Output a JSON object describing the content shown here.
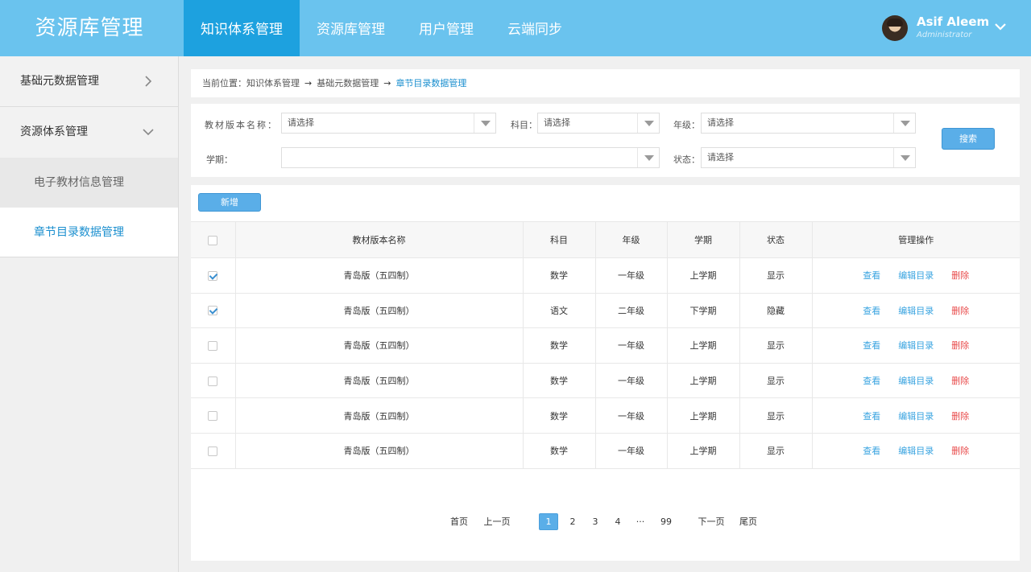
{
  "header": {
    "logo": "资源库管理",
    "nav": [
      {
        "label": "知识体系管理",
        "active": true
      },
      {
        "label": "资源库管理",
        "active": false
      },
      {
        "label": "用户管理",
        "active": false
      },
      {
        "label": "云端同步",
        "active": false
      }
    ],
    "user": {
      "name": "Asif Aleem",
      "role": "Administrator"
    }
  },
  "sidebar": {
    "items": [
      {
        "label": "基础元数据管理",
        "icon": "chevron-right-icon"
      },
      {
        "label": "资源体系管理",
        "icon": "chevron-down-icon"
      }
    ],
    "subitems": [
      {
        "label": "电子教材信息管理",
        "active": false
      },
      {
        "label": "章节目录数据管理",
        "active": true
      }
    ]
  },
  "breadcrumb": {
    "prefix": "当前位置：",
    "items": [
      "知识体系管理",
      "基础元数据管理",
      "章节目录数据管理"
    ],
    "separator": "→"
  },
  "filters": {
    "edition_label": "教材版本名称：",
    "edition_value": "请选择",
    "subject_label": "科目：",
    "subject_value": "请选择",
    "grade_label": "年级：",
    "grade_value": "请选择",
    "term_label": "学期：",
    "term_value": "",
    "status_label": "状态：",
    "status_value": "请选择",
    "search_label": "搜索"
  },
  "toolbar": {
    "add_label": "新增"
  },
  "table": {
    "headers": [
      "教材版本名称",
      "科目",
      "年级",
      "学期",
      "状态",
      "管理操作"
    ],
    "actions": {
      "view": "查看",
      "edit": "编辑目录",
      "delete": "删除"
    },
    "rows": [
      {
        "checked": true,
        "edition": "青岛版（五四制）",
        "subject": "数学",
        "grade": "一年级",
        "term": "上学期",
        "status": "显示"
      },
      {
        "checked": true,
        "edition": "青岛版（五四制）",
        "subject": "语文",
        "grade": "二年级",
        "term": "下学期",
        "status": "隐藏"
      },
      {
        "checked": false,
        "edition": "青岛版（五四制）",
        "subject": "数学",
        "grade": "一年级",
        "term": "上学期",
        "status": "显示"
      },
      {
        "checked": false,
        "edition": "青岛版（五四制）",
        "subject": "数学",
        "grade": "一年级",
        "term": "上学期",
        "status": "显示"
      },
      {
        "checked": false,
        "edition": "青岛版（五四制）",
        "subject": "数学",
        "grade": "一年级",
        "term": "上学期",
        "status": "显示"
      },
      {
        "checked": false,
        "edition": "青岛版（五四制）",
        "subject": "数学",
        "grade": "一年级",
        "term": "上学期",
        "status": "显示"
      }
    ]
  },
  "pagination": {
    "first": "首页",
    "prev": "上一页",
    "pages": [
      "1",
      "2",
      "3",
      "4"
    ],
    "ellipsis": "···",
    "last_page": "99",
    "current": "1",
    "next": "下一页",
    "end": "尾页"
  },
  "colors": {
    "header_bg": "#6ac3ee",
    "nav_active": "#1da1df",
    "accent": "#5aaee8",
    "danger": "#e84a4a",
    "link": "#3aa4e0"
  }
}
